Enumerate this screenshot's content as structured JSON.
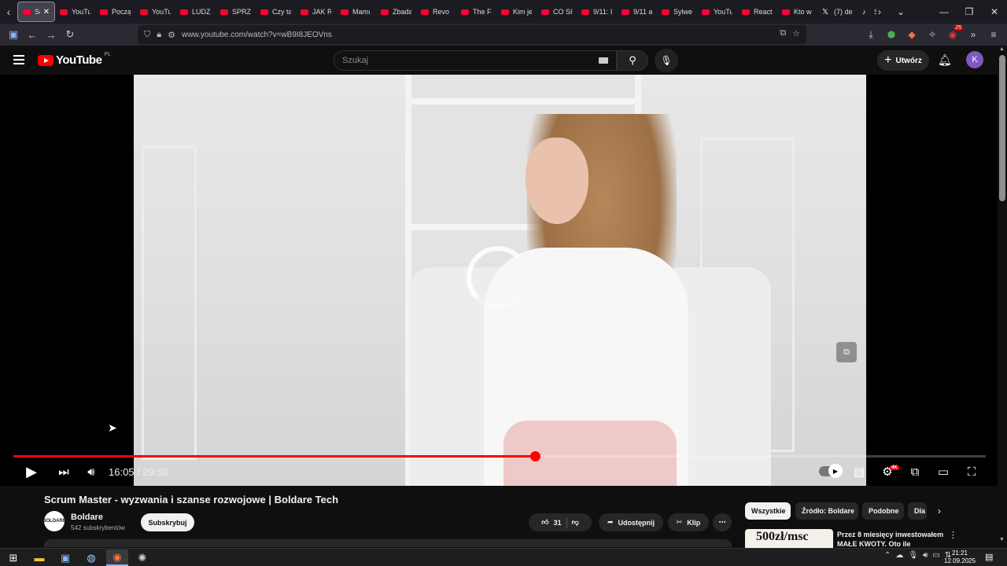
{
  "browser": {
    "tabs": [
      {
        "label": "Scr",
        "icon": "youtube-icon",
        "active": true
      },
      {
        "label": "YouTu",
        "icon": "youtube-icon"
      },
      {
        "label": "Począ",
        "icon": "youtube-icon"
      },
      {
        "label": "YouTu",
        "icon": "youtube-icon"
      },
      {
        "label": "LUDZI",
        "icon": "youtube-icon"
      },
      {
        "label": "SPRZA",
        "icon": "youtube-icon"
      },
      {
        "label": "Czy ta",
        "icon": "youtube-icon"
      },
      {
        "label": "JAK R",
        "icon": "youtube-icon"
      },
      {
        "label": "Mamı",
        "icon": "youtube-icon"
      },
      {
        "label": "Zbada",
        "icon": "youtube-icon"
      },
      {
        "label": "Revo",
        "icon": "youtube-icon"
      },
      {
        "label": "The Fi",
        "icon": "youtube-icon"
      },
      {
        "label": "Kim je",
        "icon": "youtube-icon"
      },
      {
        "label": "CO SI",
        "icon": "youtube-icon"
      },
      {
        "label": "9/11: I",
        "icon": "youtube-icon"
      },
      {
        "label": "9/11 a",
        "icon": "youtube-icon"
      },
      {
        "label": "Sylwe",
        "icon": "youtube-icon"
      },
      {
        "label": "YouTu",
        "icon": "youtube-icon"
      },
      {
        "label": "React",
        "icon": "youtube-icon"
      },
      {
        "label": "Kto w",
        "icon": "youtube-icon"
      },
      {
        "label": "(7) de",
        "icon": "x-icon"
      },
      {
        "label": "Sp",
        "icon": "tiktok-icon"
      }
    ],
    "url": "www.youtube.com/watch?v=wB9I8JEOVns",
    "extension_badge": "25"
  },
  "youtube": {
    "logo_text": "YouTube",
    "country_code": "PL",
    "search_placeholder": "Szukaj",
    "create_label": "Utwórz",
    "avatar_letter": "K"
  },
  "player": {
    "current_time": "16:05",
    "duration": "29:59",
    "time_display": "16:05 / 29:59",
    "played_fraction": 0.5364,
    "loaded_fraction": 0.5364,
    "quality_badge": "4K"
  },
  "video": {
    "title": "Scrum Master - wyzwania i szanse rozwojowe | Boldare Tech",
    "channel_name": "Boldare",
    "channel_logo_text": "BOLDARE",
    "subscribers": "542 subskrybentów",
    "subscribe_label": "Subskrybuj",
    "likes": "31",
    "share_label": "Udostępnij",
    "clip_label": "Klip"
  },
  "sidebar": {
    "chips": [
      "Wszystkie",
      "Źródło: Boldare",
      "Podobne",
      "Dla"
    ],
    "recommendation": {
      "thumb_text": "500zł/msc",
      "title": "Przez 8 miesięcy inwestowałem MAŁE KWOTY. Oto ile"
    }
  },
  "taskbar": {
    "time": "21:21",
    "date": "12.09.2025"
  },
  "colors": {
    "accent_red": "#ff0000",
    "progress_red": "#f00",
    "background": "#0f0f0f",
    "avatar_purple": "#7e57c2"
  }
}
